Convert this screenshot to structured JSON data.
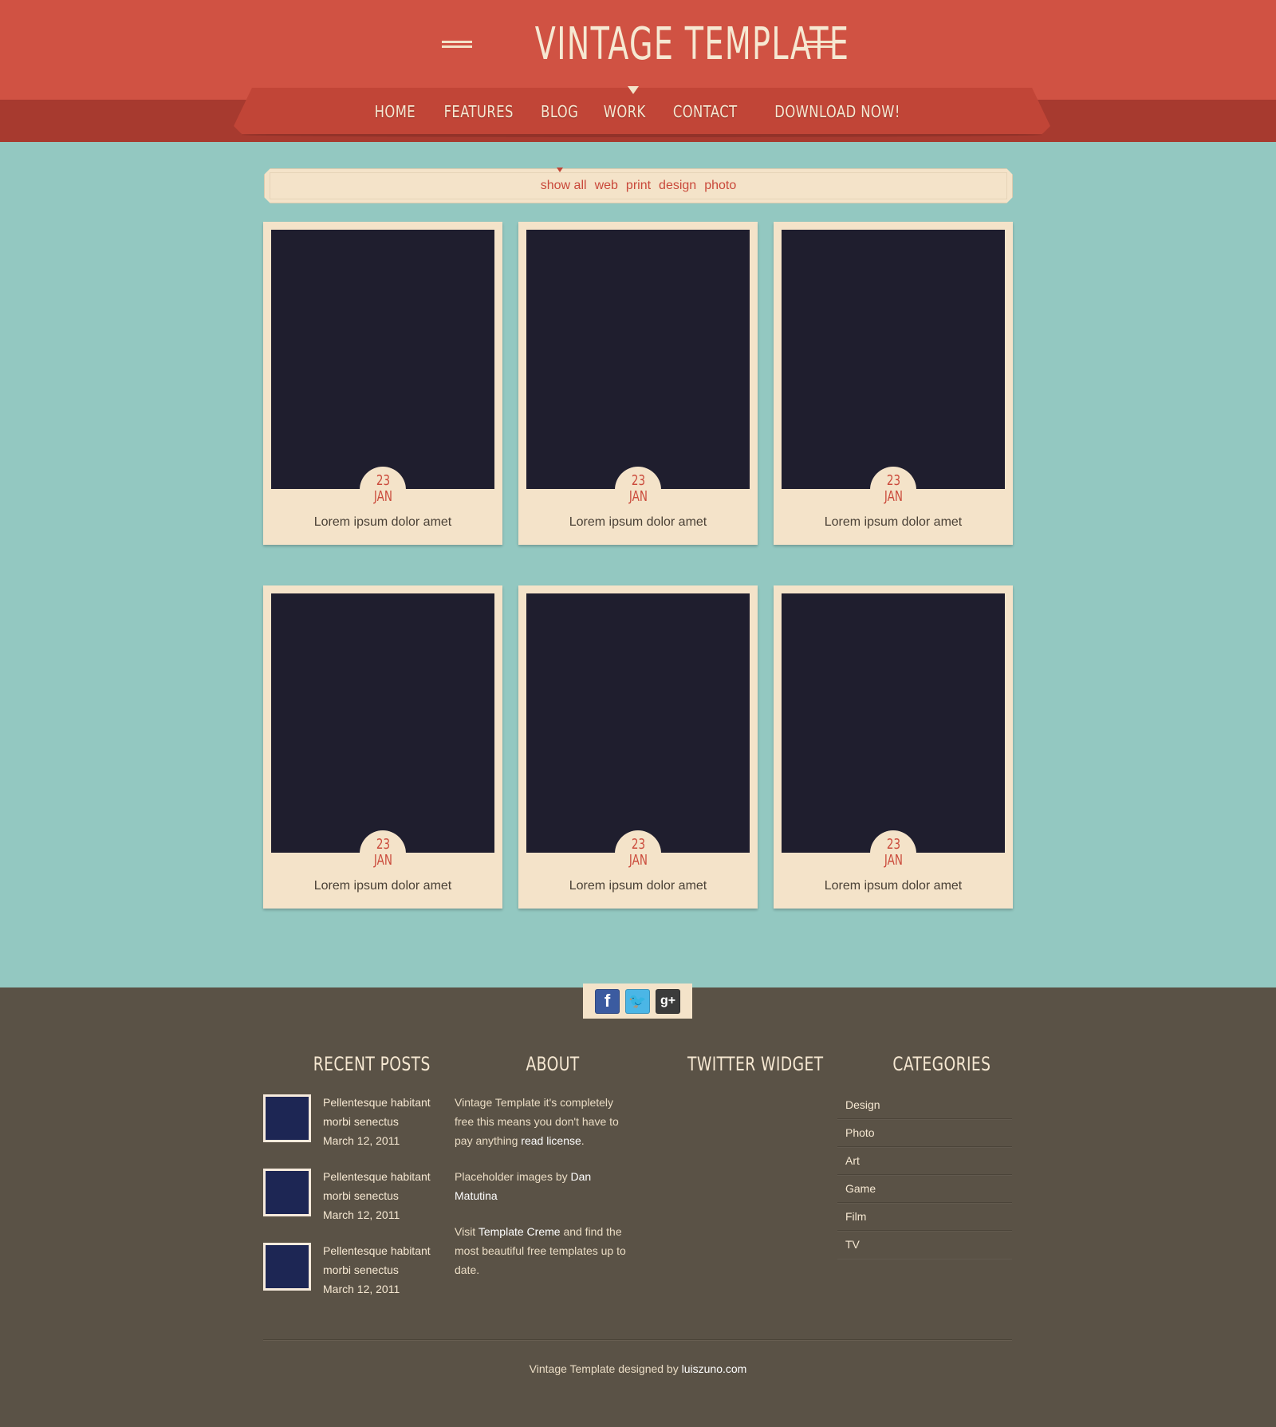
{
  "header": {
    "title": "Vintage Template",
    "nav": [
      "HOME",
      "FEATURES",
      "BLOG",
      "WORK",
      "CONTACT",
      "DOWNLOAD NOW!"
    ]
  },
  "filters": [
    "show all",
    "web",
    "print",
    "design",
    "photo"
  ],
  "portfolio": [
    {
      "day": "23",
      "month": "JAN",
      "caption": "Lorem ipsum dolor amet"
    },
    {
      "day": "23",
      "month": "JAN",
      "caption": "Lorem ipsum dolor amet"
    },
    {
      "day": "23",
      "month": "JAN",
      "caption": "Lorem ipsum dolor amet"
    },
    {
      "day": "23",
      "month": "JAN",
      "caption": "Lorem ipsum dolor amet"
    },
    {
      "day": "23",
      "month": "JAN",
      "caption": "Lorem ipsum dolor amet"
    },
    {
      "day": "23",
      "month": "JAN",
      "caption": "Lorem ipsum dolor amet"
    }
  ],
  "social": {
    "icons": [
      "facebook-icon",
      "twitter-icon",
      "google-plus-icon"
    ],
    "facebook_glyph": "f",
    "twitter_glyph": "🐦",
    "google_glyph": "g+"
  },
  "footer": {
    "headings": {
      "recent_posts": "RECENT POSTS",
      "about": "ABOUT",
      "twitter": "TWITTER WIDGET",
      "categories": "CATEGORIES"
    },
    "recent_posts": [
      {
        "title": "Pellentesque habitant morbi senectus",
        "date": "March 12, 2011"
      },
      {
        "title": "Pellentesque habitant morbi senectus",
        "date": "March 12, 2011"
      },
      {
        "title": "Pellentesque habitant morbi senectus",
        "date": "March 12, 2011"
      }
    ],
    "about": {
      "p1_a": "Vintage Template it's completely free this means you don't have to pay anything",
      "p1_link": "read license",
      "p1_end": ".",
      "p2_a": "Placeholder images by",
      "p2_link": "Dan Matutina",
      "p3_a": "Visit",
      "p3_link": "Template Creme",
      "p3_b": "and find the most beautiful free templates up to date."
    },
    "categories": [
      "Design",
      "Photo",
      "Art",
      "Game",
      "Film",
      "TV"
    ],
    "credit_text": "Vintage Template designed by",
    "credit_link": "luiszuno.com"
  },
  "colors": {
    "header_red": "#d05243",
    "band_red": "#a73a2f",
    "background_teal": "#93c8c1",
    "cream": "#f4e3c9",
    "image_placeholder": "#1f1e2e",
    "footer_brown": "#5a5246",
    "accent_red_text": "#c9483a"
  }
}
